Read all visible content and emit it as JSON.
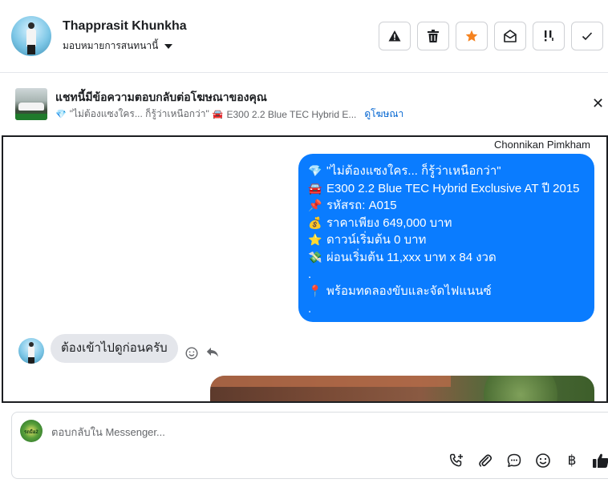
{
  "header": {
    "contact_name": "Thapprasit Khunkha",
    "assign_label": "มอบหมายการสนทนานี้",
    "actions": {
      "report": "▲!",
      "delete": "🗑",
      "star": "★",
      "mark_unread": "✉",
      "follow_up": "!!",
      "done": "✓"
    }
  },
  "banner": {
    "title": "แชทนี้มีข้อความตอบกลับต่อโฆษณาของคุณ",
    "ad_text_part1": "\"ไม่ต้องแซงใคร... ก็รู้ว่าเหนือกว่า\"",
    "ad_text_part2": "E300 2.2 Blue TEC Hybrid E...",
    "link": "ดูโฆษณา",
    "close": "✕"
  },
  "chat": {
    "sender_name": "Chonnikan Pimkham",
    "outgoing_lines": [
      "\"ไม่ต้องแซงใคร... ก็รู้ว่าเหนือกว่า\"",
      "E300 2.2 Blue TEC Hybrid Exclusive AT ปี 2015",
      "รหัสรถ: A015",
      "ราคาเพียง 649,000 บาท",
      "ดาวน์เริ่มต้น 0 บาท",
      "ผ่อนเริ่มต้น 11,xxx บาท x 84 งวด",
      ".",
      "พร้อมทดลองขับและจัดไฟแนนซ์",
      "."
    ],
    "incoming_text": "ต้องเข้าไปดูก่อนครับ"
  },
  "composer": {
    "placeholder": "ตอบกลับใน Messenger...",
    "page_avatar_text": "รถมือ2"
  },
  "colors": {
    "outgoing_bubble": "#0a7cff",
    "incoming_bubble": "#e4e6eb",
    "link": "#0064d1",
    "star": "#f5821f"
  }
}
